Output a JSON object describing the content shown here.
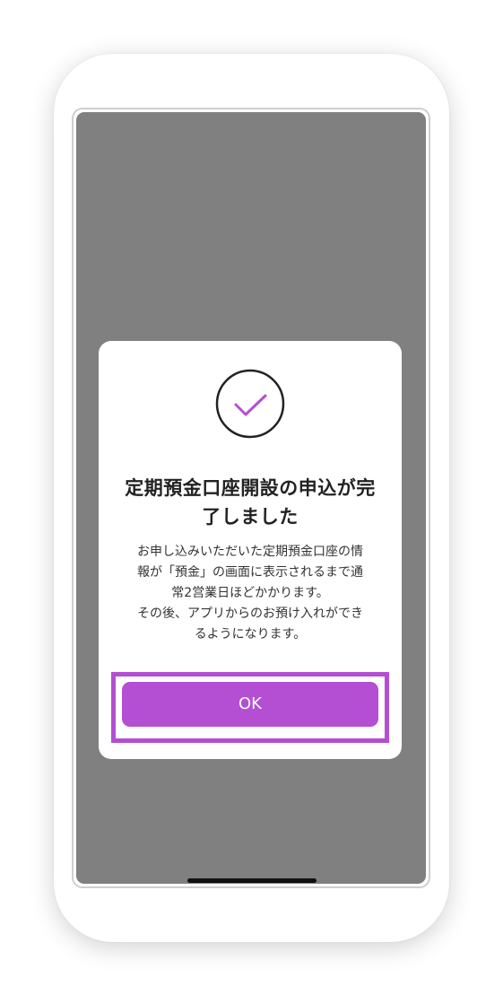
{
  "dialog": {
    "title_line1": "定期預金口座開設の申込が完",
    "title_line2": "了しました",
    "message_lines": [
      "お申し込みいただいた定期預金口座の情",
      "報が「預金」の画面に表示されるまで通",
      "常2営業日ほどかかります。",
      "その後、アプリからのお預け入れができ",
      "るようになります。"
    ],
    "ok_label": "OK",
    "icon": "check-circle-icon"
  },
  "colors": {
    "accent": "#b44ed2",
    "overlay": "#808080",
    "text": "#222222"
  }
}
